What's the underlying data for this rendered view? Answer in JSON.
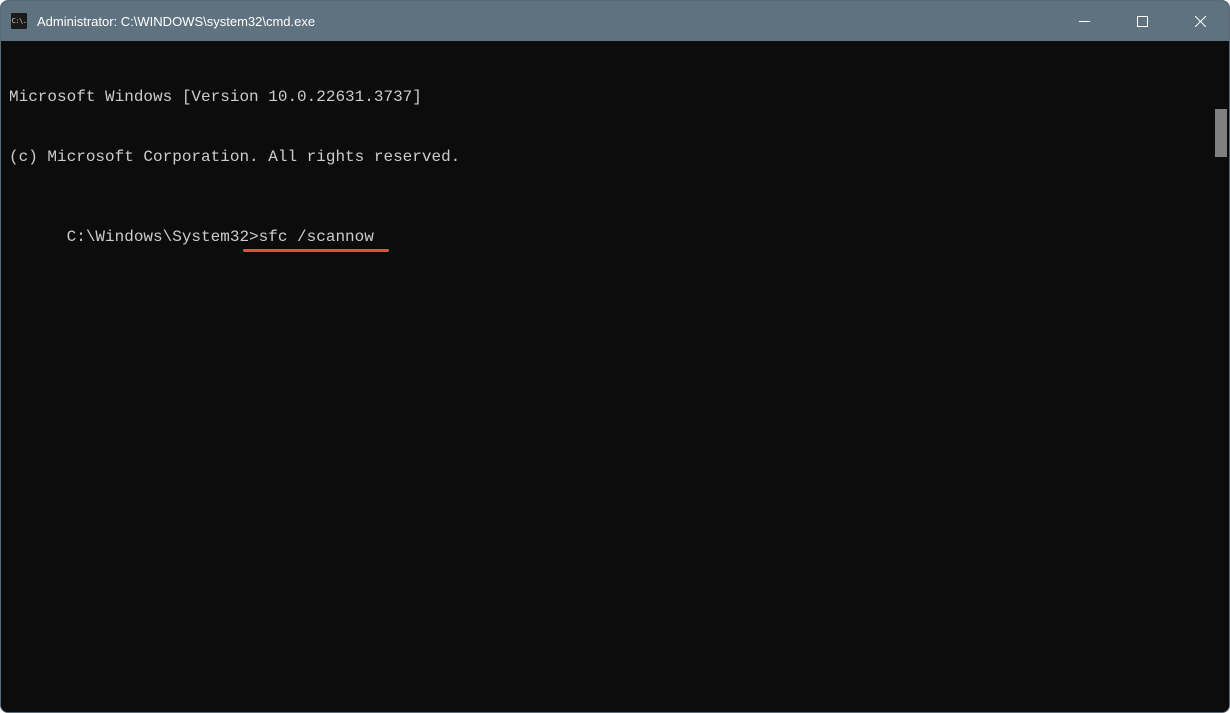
{
  "window": {
    "title": "Administrator: C:\\WINDOWS\\system32\\cmd.exe",
    "icon_text": "C:\\."
  },
  "terminal": {
    "lines": [
      "Microsoft Windows [Version 10.0.22631.3737]",
      "(c) Microsoft Corporation. All rights reserved.",
      ""
    ],
    "prompt": "C:\\Windows\\System32>",
    "command": "sfc /scannow"
  },
  "annotation": {
    "underline_color": "#e74c3c"
  }
}
